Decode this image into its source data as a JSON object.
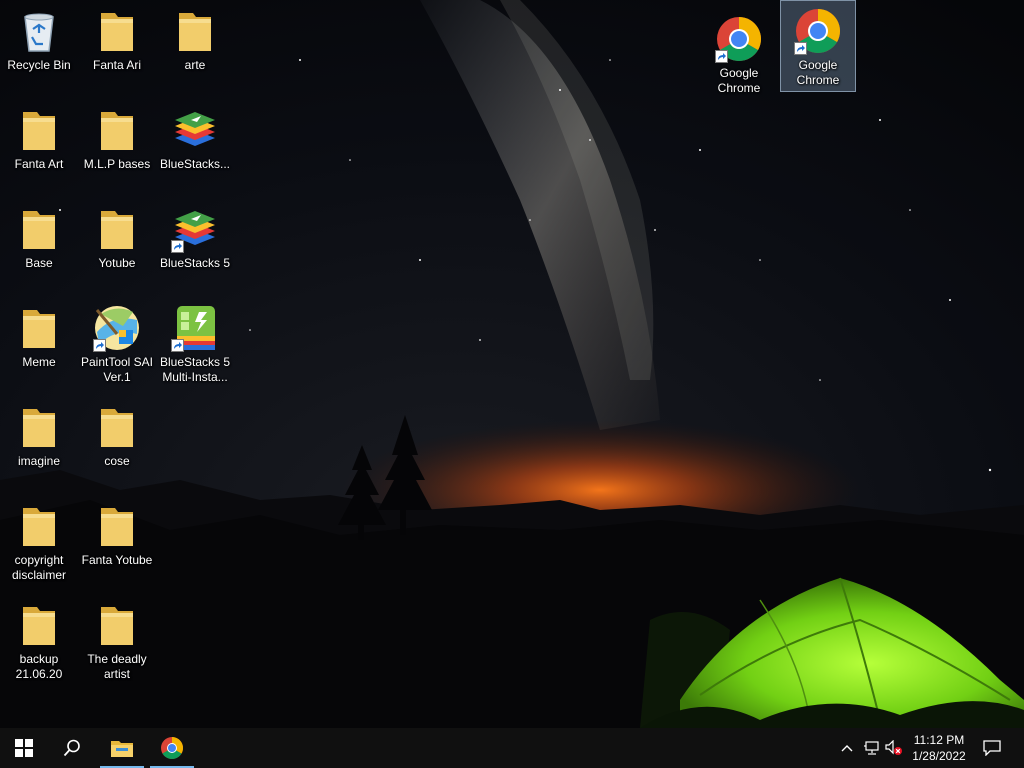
{
  "desktop": {
    "icons": [
      {
        "label": "Recycle Bin",
        "icon": "recycle-bin-icon"
      },
      {
        "label": "Fanta Art",
        "icon": "folder-icon"
      },
      {
        "label": "Base",
        "icon": "folder-icon"
      },
      {
        "label": "Meme",
        "icon": "folder-icon"
      },
      {
        "label": "imagine",
        "icon": "folder-icon"
      },
      {
        "label": "copyright disclaimer",
        "icon": "folder-icon"
      },
      {
        "label": "backup 21.06.20",
        "icon": "folder-icon"
      },
      {
        "label": "Fanta Ari",
        "icon": "folder-icon"
      },
      {
        "label": "M.L.P bases",
        "icon": "folder-icon"
      },
      {
        "label": "Yotube",
        "icon": "folder-icon"
      },
      {
        "label": "PaintTool SAI Ver.1",
        "icon": "painttool-sai-icon",
        "shortcut": true
      },
      {
        "label": "cose",
        "icon": "folder-icon"
      },
      {
        "label": "Fanta Yotube",
        "icon": "folder-icon"
      },
      {
        "label": "The deadly artist",
        "icon": "folder-icon"
      },
      {
        "label": "arte",
        "icon": "folder-icon"
      },
      {
        "label": "BlueStacks...",
        "icon": "bluestacks-icon"
      },
      {
        "label": "BlueStacks 5",
        "icon": "bluestacks-icon",
        "shortcut": true
      },
      {
        "label": "BlueStacks 5 Multi-Insta...",
        "icon": "bluestacks-multi-instance-icon",
        "shortcut": true
      },
      {
        "label": "Google Chrome",
        "icon": "chrome-icon",
        "shortcut": true
      },
      {
        "label": "Google Chrome",
        "icon": "chrome-icon",
        "shortcut": true,
        "selected": true
      }
    ]
  },
  "taskbar": {
    "start": "windows-start-icon",
    "search": "search-icon",
    "apps": [
      {
        "name": "File Explorer",
        "icon": "file-explorer-icon",
        "active": true
      },
      {
        "name": "Google Chrome",
        "icon": "chrome-icon",
        "active": true
      }
    ],
    "tray": {
      "icons": [
        "chevron-up-icon",
        "network-icon",
        "volume-muted-icon"
      ],
      "time": "11:12 PM",
      "date": "1/28/2022",
      "notifications": "action-center-icon"
    }
  },
  "colors": {
    "taskbar": "#101010",
    "folder": "#f2cd6b",
    "active_indicator": "#76b9ed",
    "tent": "#7ad81e"
  }
}
